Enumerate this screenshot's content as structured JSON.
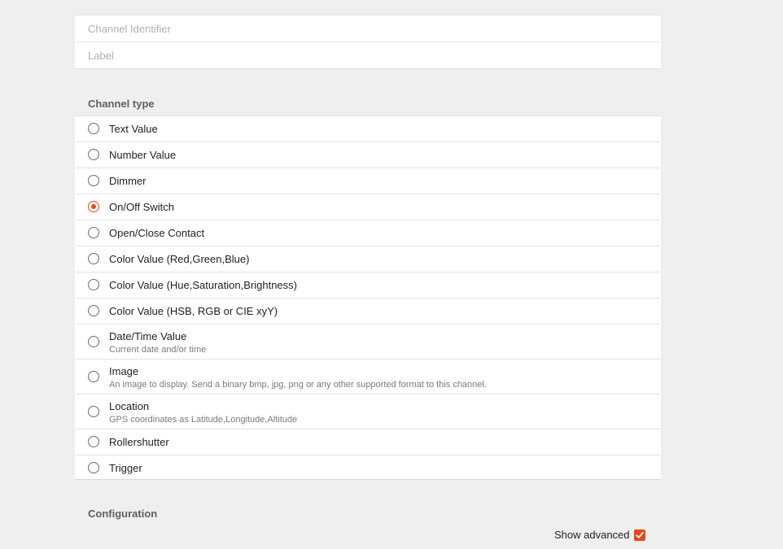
{
  "fields": {
    "channel_identifier_placeholder": "Channel Identifier",
    "channel_identifier_value": "",
    "label_placeholder": "Label",
    "label_value": ""
  },
  "channel_type": {
    "title": "Channel type",
    "selected": "On/Off Switch",
    "options": [
      {
        "label": "Text Value",
        "description": ""
      },
      {
        "label": "Number Value",
        "description": ""
      },
      {
        "label": "Dimmer",
        "description": ""
      },
      {
        "label": "On/Off Switch",
        "description": ""
      },
      {
        "label": "Open/Close Contact",
        "description": ""
      },
      {
        "label": "Color Value (Red,Green,Blue)",
        "description": ""
      },
      {
        "label": "Color Value (Hue,Saturation,Brightness)",
        "description": ""
      },
      {
        "label": "Color Value (HSB, RGB or CIE xyY)",
        "description": ""
      },
      {
        "label": "Date/Time Value",
        "description": "Current date and/or time"
      },
      {
        "label": "Image",
        "description": "An image to display. Send a binary bmp, jpg, png or any other supported format to this channel."
      },
      {
        "label": "Location",
        "description": "GPS coordinates as Latitude,Longitude,Altitude"
      },
      {
        "label": "Rollershutter",
        "description": ""
      },
      {
        "label": "Trigger",
        "description": ""
      }
    ]
  },
  "configuration": {
    "title": "Configuration",
    "show_advanced_label": "Show advanced",
    "show_advanced_checked": true
  },
  "colors": {
    "accent": "#e64a19",
    "background": "#efefef",
    "panel": "#ffffff"
  }
}
